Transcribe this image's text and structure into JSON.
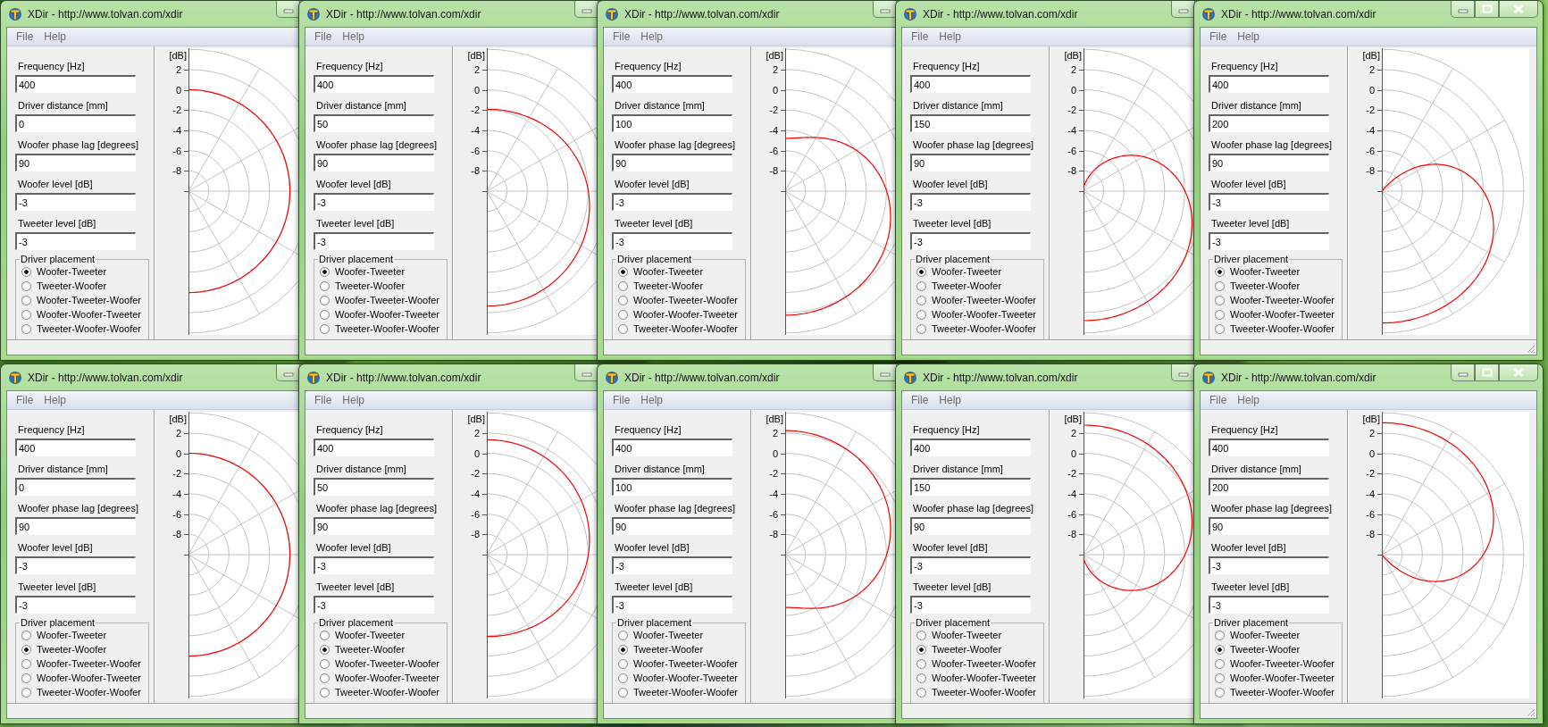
{
  "windows": [
    {
      "title": "XDir - http://www.tolvan.com/xdir",
      "menu": [
        "File",
        "Help"
      ],
      "fields": [
        {
          "label": "Frequency [Hz]",
          "value": "400"
        },
        {
          "label": "Driver distance [mm]",
          "value": "0"
        },
        {
          "label": "Woofer phase lag [degrees]",
          "value": "90"
        },
        {
          "label": "Woofer level [dB]",
          "value": "-3"
        },
        {
          "label": "Tweeter level [dB]",
          "value": "-3"
        }
      ],
      "placement": {
        "title": "Driver placement",
        "options": [
          {
            "label": "Woofer-Tweeter",
            "selected": true
          },
          {
            "label": "Tweeter-Woofer",
            "selected": false
          },
          {
            "label": "Woofer-Tweeter-Woofer",
            "selected": false
          },
          {
            "label": "Woofer-Woofer-Tweeter",
            "selected": false
          },
          {
            "label": "Tweeter-Woofer-Woofer",
            "selected": false
          }
        ]
      },
      "plot": {
        "unit": "[dB]",
        "ticks": [
          "2",
          "0",
          "-2",
          "-4",
          "-6",
          "-8"
        ]
      }
    },
    {
      "title": "XDir - http://www.tolvan.com/xdir",
      "menu": [
        "File",
        "Help"
      ],
      "fields": [
        {
          "label": "Frequency [Hz]",
          "value": "400"
        },
        {
          "label": "Driver distance [mm]",
          "value": "50"
        },
        {
          "label": "Woofer phase lag [degrees]",
          "value": "90"
        },
        {
          "label": "Woofer level [dB]",
          "value": "-3"
        },
        {
          "label": "Tweeter level [dB]",
          "value": "-3"
        }
      ],
      "placement": {
        "title": "Driver placement",
        "options": [
          {
            "label": "Woofer-Tweeter",
            "selected": true
          },
          {
            "label": "Tweeter-Woofer",
            "selected": false
          },
          {
            "label": "Woofer-Tweeter-Woofer",
            "selected": false
          },
          {
            "label": "Woofer-Woofer-Tweeter",
            "selected": false
          },
          {
            "label": "Tweeter-Woofer-Woofer",
            "selected": false
          }
        ]
      },
      "plot": {
        "unit": "[dB]",
        "ticks": [
          "2",
          "0",
          "-2",
          "-4",
          "-6",
          "-8"
        ]
      }
    },
    {
      "title": "XDir - http://www.tolvan.com/xdir",
      "menu": [
        "File",
        "Help"
      ],
      "fields": [
        {
          "label": "Frequency [Hz]",
          "value": "400"
        },
        {
          "label": "Driver distance [mm]",
          "value": "100"
        },
        {
          "label": "Woofer phase lag [degrees]",
          "value": "90"
        },
        {
          "label": "Woofer level [dB]",
          "value": "-3"
        },
        {
          "label": "Tweeter level [dB]",
          "value": "-3"
        }
      ],
      "placement": {
        "title": "Driver placement",
        "options": [
          {
            "label": "Woofer-Tweeter",
            "selected": true
          },
          {
            "label": "Tweeter-Woofer",
            "selected": false
          },
          {
            "label": "Woofer-Tweeter-Woofer",
            "selected": false
          },
          {
            "label": "Woofer-Woofer-Tweeter",
            "selected": false
          },
          {
            "label": "Tweeter-Woofer-Woofer",
            "selected": false
          }
        ]
      },
      "plot": {
        "unit": "[dB]",
        "ticks": [
          "2",
          "0",
          "-2",
          "-4",
          "-6",
          "-8"
        ]
      }
    },
    {
      "title": "XDir - http://www.tolvan.com/xdir",
      "menu": [
        "File",
        "Help"
      ],
      "fields": [
        {
          "label": "Frequency [Hz]",
          "value": "400"
        },
        {
          "label": "Driver distance [mm]",
          "value": "150"
        },
        {
          "label": "Woofer phase lag [degrees]",
          "value": "90"
        },
        {
          "label": "Woofer level [dB]",
          "value": "-3"
        },
        {
          "label": "Tweeter level [dB]",
          "value": "-3"
        }
      ],
      "placement": {
        "title": "Driver placement",
        "options": [
          {
            "label": "Woofer-Tweeter",
            "selected": true
          },
          {
            "label": "Tweeter-Woofer",
            "selected": false
          },
          {
            "label": "Woofer-Tweeter-Woofer",
            "selected": false
          },
          {
            "label": "Woofer-Woofer-Tweeter",
            "selected": false
          },
          {
            "label": "Tweeter-Woofer-Woofer",
            "selected": false
          }
        ]
      },
      "plot": {
        "unit": "[dB]",
        "ticks": [
          "2",
          "0",
          "-2",
          "-4",
          "-6",
          "-8"
        ]
      }
    },
    {
      "title": "XDir - http://www.tolvan.com/xdir",
      "menu": [
        "File",
        "Help"
      ],
      "fields": [
        {
          "label": "Frequency [Hz]",
          "value": "400"
        },
        {
          "label": "Driver distance [mm]",
          "value": "200"
        },
        {
          "label": "Woofer phase lag [degrees]",
          "value": "90"
        },
        {
          "label": "Woofer level [dB]",
          "value": "-3"
        },
        {
          "label": "Tweeter level [dB]",
          "value": "-3"
        }
      ],
      "placement": {
        "title": "Driver placement",
        "options": [
          {
            "label": "Woofer-Tweeter",
            "selected": true
          },
          {
            "label": "Tweeter-Woofer",
            "selected": false
          },
          {
            "label": "Woofer-Tweeter-Woofer",
            "selected": false
          },
          {
            "label": "Woofer-Woofer-Tweeter",
            "selected": false
          },
          {
            "label": "Tweeter-Woofer-Woofer",
            "selected": false
          }
        ]
      },
      "plot": {
        "unit": "[dB]",
        "ticks": [
          "2",
          "0",
          "-2",
          "-4",
          "-6",
          "-8"
        ]
      }
    },
    {
      "title": "XDir - http://www.tolvan.com/xdir",
      "menu": [
        "File",
        "Help"
      ],
      "fields": [
        {
          "label": "Frequency [Hz]",
          "value": "400"
        },
        {
          "label": "Driver distance [mm]",
          "value": "0"
        },
        {
          "label": "Woofer phase lag [degrees]",
          "value": "90"
        },
        {
          "label": "Woofer level [dB]",
          "value": "-3"
        },
        {
          "label": "Tweeter level [dB]",
          "value": "-3"
        }
      ],
      "placement": {
        "title": "Driver placement",
        "options": [
          {
            "label": "Woofer-Tweeter",
            "selected": false
          },
          {
            "label": "Tweeter-Woofer",
            "selected": true
          },
          {
            "label": "Woofer-Tweeter-Woofer",
            "selected": false
          },
          {
            "label": "Woofer-Woofer-Tweeter",
            "selected": false
          },
          {
            "label": "Tweeter-Woofer-Woofer",
            "selected": false
          }
        ]
      },
      "plot": {
        "unit": "[dB]",
        "ticks": [
          "2",
          "0",
          "-2",
          "-4",
          "-6",
          "-8"
        ]
      }
    },
    {
      "title": "XDir - http://www.tolvan.com/xdir",
      "menu": [
        "File",
        "Help"
      ],
      "fields": [
        {
          "label": "Frequency [Hz]",
          "value": "400"
        },
        {
          "label": "Driver distance [mm]",
          "value": "50"
        },
        {
          "label": "Woofer phase lag [degrees]",
          "value": "90"
        },
        {
          "label": "Woofer level [dB]",
          "value": "-3"
        },
        {
          "label": "Tweeter level [dB]",
          "value": "-3"
        }
      ],
      "placement": {
        "title": "Driver placement",
        "options": [
          {
            "label": "Woofer-Tweeter",
            "selected": false
          },
          {
            "label": "Tweeter-Woofer",
            "selected": true
          },
          {
            "label": "Woofer-Tweeter-Woofer",
            "selected": false
          },
          {
            "label": "Woofer-Woofer-Tweeter",
            "selected": false
          },
          {
            "label": "Tweeter-Woofer-Woofer",
            "selected": false
          }
        ]
      },
      "plot": {
        "unit": "[dB]",
        "ticks": [
          "2",
          "0",
          "-2",
          "-4",
          "-6",
          "-8"
        ]
      }
    },
    {
      "title": "XDir - http://www.tolvan.com/xdir",
      "menu": [
        "File",
        "Help"
      ],
      "fields": [
        {
          "label": "Frequency [Hz]",
          "value": "400"
        },
        {
          "label": "Driver distance [mm]",
          "value": "100"
        },
        {
          "label": "Woofer phase lag [degrees]",
          "value": "90"
        },
        {
          "label": "Woofer level [dB]",
          "value": "-3"
        },
        {
          "label": "Tweeter level [dB]",
          "value": "-3"
        }
      ],
      "placement": {
        "title": "Driver placement",
        "options": [
          {
            "label": "Woofer-Tweeter",
            "selected": false
          },
          {
            "label": "Tweeter-Woofer",
            "selected": true
          },
          {
            "label": "Woofer-Tweeter-Woofer",
            "selected": false
          },
          {
            "label": "Woofer-Woofer-Tweeter",
            "selected": false
          },
          {
            "label": "Tweeter-Woofer-Woofer",
            "selected": false
          }
        ]
      },
      "plot": {
        "unit": "[dB]",
        "ticks": [
          "2",
          "0",
          "-2",
          "-4",
          "-6",
          "-8"
        ]
      }
    },
    {
      "title": "XDir - http://www.tolvan.com/xdir",
      "menu": [
        "File",
        "Help"
      ],
      "fields": [
        {
          "label": "Frequency [Hz]",
          "value": "400"
        },
        {
          "label": "Driver distance [mm]",
          "value": "150"
        },
        {
          "label": "Woofer phase lag [degrees]",
          "value": "90"
        },
        {
          "label": "Woofer level [dB]",
          "value": "-3"
        },
        {
          "label": "Tweeter level [dB]",
          "value": "-3"
        }
      ],
      "placement": {
        "title": "Driver placement",
        "options": [
          {
            "label": "Woofer-Tweeter",
            "selected": false
          },
          {
            "label": "Tweeter-Woofer",
            "selected": true
          },
          {
            "label": "Woofer-Tweeter-Woofer",
            "selected": false
          },
          {
            "label": "Woofer-Woofer-Tweeter",
            "selected": false
          },
          {
            "label": "Tweeter-Woofer-Woofer",
            "selected": false
          }
        ]
      },
      "plot": {
        "unit": "[dB]",
        "ticks": [
          "2",
          "0",
          "-2",
          "-4",
          "-6",
          "-8"
        ]
      }
    },
    {
      "title": "XDir - http://www.tolvan.com/xdir",
      "menu": [
        "File",
        "Help"
      ],
      "fields": [
        {
          "label": "Frequency [Hz]",
          "value": "400"
        },
        {
          "label": "Driver distance [mm]",
          "value": "200"
        },
        {
          "label": "Woofer phase lag [degrees]",
          "value": "90"
        },
        {
          "label": "Woofer level [dB]",
          "value": "-3"
        },
        {
          "label": "Tweeter level [dB]",
          "value": "-3"
        }
      ],
      "placement": {
        "title": "Driver placement",
        "options": [
          {
            "label": "Woofer-Tweeter",
            "selected": false
          },
          {
            "label": "Tweeter-Woofer",
            "selected": true
          },
          {
            "label": "Woofer-Tweeter-Woofer",
            "selected": false
          },
          {
            "label": "Woofer-Woofer-Tweeter",
            "selected": false
          },
          {
            "label": "Tweeter-Woofer-Woofer",
            "selected": false
          }
        ]
      },
      "plot": {
        "unit": "[dB]",
        "ticks": [
          "2",
          "0",
          "-2",
          "-4",
          "-6",
          "-8"
        ]
      }
    }
  ]
}
